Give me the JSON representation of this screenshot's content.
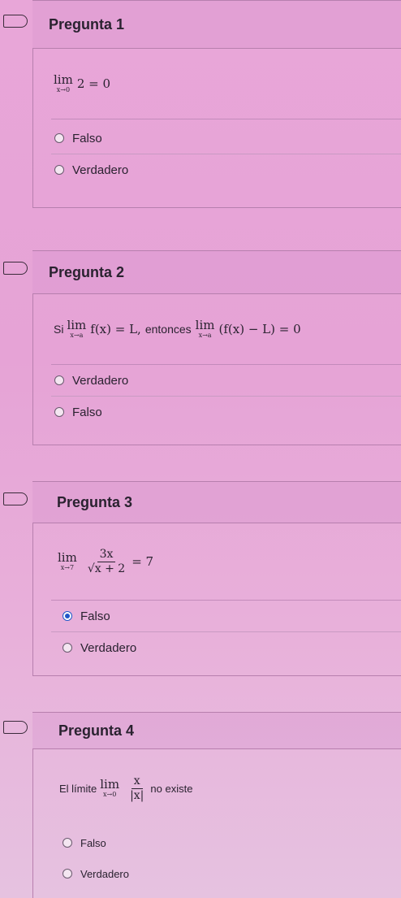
{
  "questions": [
    {
      "title": "Pregunta 1",
      "statement": {
        "lim_top": "lim",
        "lim_sub": "x→0",
        "rest": "2 = 0"
      },
      "options": [
        {
          "label": "Falso",
          "selected": false
        },
        {
          "label": "Verdadero",
          "selected": false
        }
      ]
    },
    {
      "title": "Pregunta 2",
      "statement": {
        "prefix": "Si",
        "lim1_top": "lim",
        "lim1_sub": "x→a",
        "expr1": "f(x) = L,",
        "middle": "entonces",
        "lim2_top": "lim",
        "lim2_sub": "x→a",
        "expr2": "(f(x) − L) = 0"
      },
      "options": [
        {
          "label": "Verdadero",
          "selected": false
        },
        {
          "label": "Falso",
          "selected": false
        }
      ]
    },
    {
      "title": "Pregunta 3",
      "statement": {
        "lim_top": "lim",
        "lim_sub": "x→7",
        "num": "3x",
        "den": "√x + 2",
        "rest": "= 7"
      },
      "options": [
        {
          "label": "Falso",
          "selected": true
        },
        {
          "label": "Verdadero",
          "selected": false
        }
      ]
    },
    {
      "title": "Pregunta 4",
      "statement": {
        "prefix": "El límite",
        "lim_top": "lim",
        "lim_sub": "x→0",
        "num": "x",
        "den": "|x|",
        "suffix": "no existe"
      },
      "options": [
        {
          "label": "Falso",
          "selected": false
        },
        {
          "label": "Verdadero",
          "selected": false
        }
      ]
    }
  ]
}
